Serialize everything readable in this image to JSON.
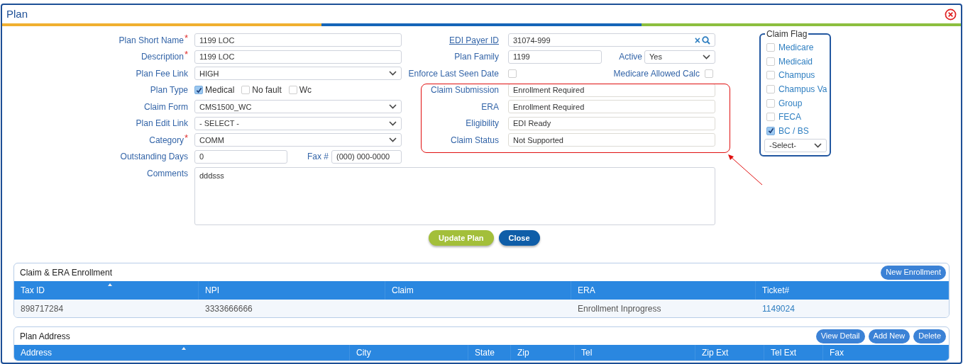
{
  "window": {
    "title": "Plan"
  },
  "left_fields": [
    {
      "kind": "text",
      "label": "Plan Short Name",
      "required_mark": "*",
      "value": "1199 LOC"
    },
    {
      "kind": "text",
      "label": "Description",
      "required_mark": "*",
      "value": "1199 LOC"
    },
    {
      "kind": "select",
      "label": "Plan Fee Link",
      "value": "HIGH"
    },
    {
      "kind": "checks",
      "label": "Plan Type",
      "options": [
        {
          "label": "Medical",
          "checked": true
        },
        {
          "label": "No fault",
          "checked": false
        },
        {
          "label": "Wc",
          "checked": false
        }
      ]
    },
    {
      "kind": "select",
      "label": "Claim Form",
      "value": "CMS1500_WC"
    },
    {
      "kind": "select",
      "label": "Plan Edit Link",
      "value": "- SELECT -"
    },
    {
      "kind": "select",
      "label": "Category",
      "required_mark": "*",
      "value": "COMM"
    },
    {
      "kind": "pair",
      "label": "Outstanding Days",
      "value": "0",
      "second_label": "Fax #",
      "second_value": "(000) 000-0000"
    }
  ],
  "middle_fields": [
    {
      "kind": "lookup",
      "label": "EDI Payer ID",
      "value": "31074-999",
      "clear": "×"
    },
    {
      "kind": "text_select",
      "label": "Plan Family",
      "value": "1199",
      "second_label": "Active",
      "second_value": "Yes"
    },
    {
      "kind": "checkbox_pair",
      "label": "Enforce Last Seen Date",
      "checked": false,
      "second_label": "Medicare Allowed Calc",
      "second_checked": false
    }
  ],
  "status_fields": [
    {
      "label": "Claim Submission",
      "value": "Enrollment Required"
    },
    {
      "label": "ERA",
      "value": "Enrollment Required"
    },
    {
      "label": "Eligibility",
      "value": "EDI Ready"
    },
    {
      "label": "Claim Status",
      "value": "Not Supported"
    }
  ],
  "claim_flag": {
    "title": "Claim Flag",
    "items": [
      {
        "label": "Medicare",
        "checked": false
      },
      {
        "label": "Medicaid",
        "checked": false
      },
      {
        "label": "Champus",
        "checked": false
      },
      {
        "label": "Champus Va",
        "checked": false
      },
      {
        "label": "Group",
        "checked": false
      },
      {
        "label": "FECA",
        "checked": false
      },
      {
        "label": "BC / BS",
        "checked": true
      }
    ],
    "select": "-Select-"
  },
  "comments": {
    "label": "Comments",
    "value": "dddsss"
  },
  "buttons": [
    {
      "label": "Update Plan",
      "kind": "primary"
    },
    {
      "label": "Close",
      "kind": "secondary"
    }
  ],
  "enrollment": {
    "title": "Claim & ERA Enrollment",
    "buttons": [
      "New Enrollment"
    ],
    "columns": [
      {
        "label": "Tax ID",
        "sorted": true
      },
      {
        "label": "NPI",
        "sorted": false
      },
      {
        "label": "Claim",
        "sorted": false
      },
      {
        "label": "ERA",
        "sorted": false
      },
      {
        "label": "Ticket#",
        "sorted": false,
        "kind": "link"
      }
    ],
    "rows": [
      [
        "898717284",
        "3333666666",
        null,
        "Enrollment Inprogress",
        "1149024"
      ]
    ]
  },
  "address": {
    "title": "Plan Address",
    "buttons": [
      "View Detail",
      "Add New",
      "Delete"
    ],
    "columns": [
      {
        "label": "Address",
        "sorted": true
      },
      {
        "label": "City",
        "sorted": false
      },
      {
        "label": "State",
        "sorted": false
      },
      {
        "label": "Zip",
        "sorted": false
      },
      {
        "label": "Tel",
        "sorted": false
      },
      {
        "label": "Zip Ext",
        "sorted": false
      },
      {
        "label": "Tel Ext",
        "sorted": false
      },
      {
        "label": "Fax",
        "sorted": false
      }
    ]
  }
}
